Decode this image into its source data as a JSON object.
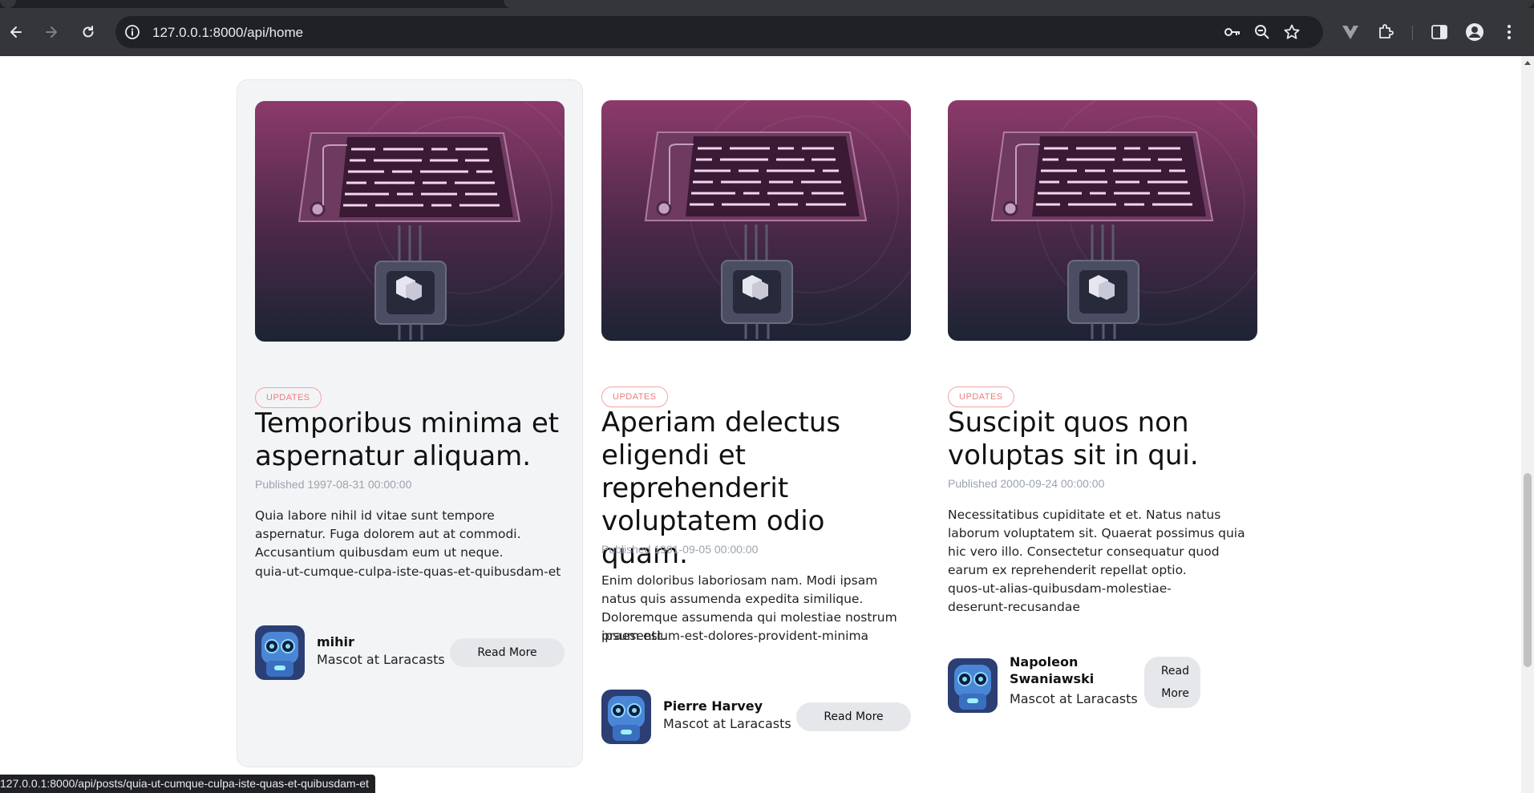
{
  "browser": {
    "url": "127.0.0.1:8000/api/home",
    "status_url": "127.0.0.1:8000/api/posts/quia-ut-cumque-culpa-iste-quas-et-quibusdam-et"
  },
  "posts": [
    {
      "tag": "UPDATES",
      "title": "Temporibus minima et aspernatur aliquam.",
      "published": "Published 1997-08-31 00:00:00",
      "excerpt": "Quia labore nihil id vitae sunt tempore aspernatur. Fuga dolorem aut at commodi. Accusantium quibusdam eum ut neque.",
      "slug": "quia-ut-cumque-culpa-iste-quas-et-quibusdam-et",
      "author": "mihir",
      "author_role": "Mascot at Laracasts",
      "button": "Read More"
    },
    {
      "tag": "UPDATES",
      "title": "Aperiam delectus eligendi et reprehenderit voluptatem odio quam.",
      "published": "Published 1991-09-05 00:00:00",
      "excerpt": "Enim doloribus laboriosam nam. Modi ipsam natus quis assumenda expedita similique. Doloremque assumenda qui molestiae nostrum ipsum est.",
      "slug": "praesentium-est-dolores-provident-minima",
      "author": "Pierre Harvey",
      "author_role": "Mascot at Laracasts",
      "button": "Read More"
    },
    {
      "tag": "UPDATES",
      "title": "Suscipit quos non voluptas sit in qui.",
      "published": "Published 2000-09-24 00:00:00",
      "excerpt": "Necessitatibus cupiditate et et. Natus natus laborum voluptatem sit. Quaerat possimus quia hic vero illo. Consectetur consequatur quod earum ex reprehenderit repellat optio.",
      "slug": "quos-ut-alias-quibusdam-molestiae-deserunt-recusandae",
      "author": "Napoleon Swaniawski",
      "author_role": "Mascot at Laracasts",
      "button": "Read More"
    }
  ],
  "colors": {
    "tag": "#f07b7b",
    "card_hover": "#f3f4f6",
    "button_bg": "#e5e7eb",
    "chrome_dark": "#35363a"
  }
}
